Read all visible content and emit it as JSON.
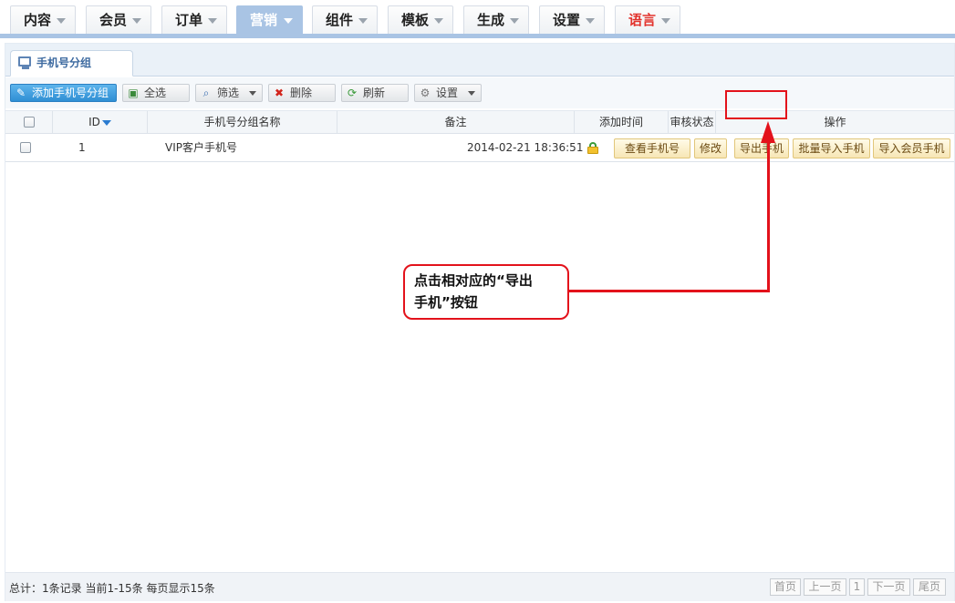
{
  "nav": {
    "items": [
      {
        "label": "内容"
      },
      {
        "label": "会员"
      },
      {
        "label": "订单"
      },
      {
        "label": "营销"
      },
      {
        "label": "组件"
      },
      {
        "label": "模板"
      },
      {
        "label": "生成"
      },
      {
        "label": "设置"
      },
      {
        "label": "语言"
      }
    ],
    "active": "营销"
  },
  "tab": {
    "label": "手机号分组"
  },
  "toolbar": {
    "add": "添加手机号分组",
    "select_all": "全选",
    "filter": "筛选",
    "delete": "删除",
    "refresh": "刷新",
    "settings": "设置"
  },
  "table": {
    "headers": {
      "id": "ID",
      "name": "手机号分组名称",
      "remark": "备注",
      "added_time": "添加时间",
      "review_status": "审核状态",
      "actions": "操作"
    },
    "rows": [
      {
        "id": "1",
        "name": "VIP客户手机号",
        "remark": "",
        "added_time": "2014-02-21 18:36:51",
        "status_icon": "unlocked-icon",
        "actions": [
          "查看手机号",
          "修改",
          "导出手机",
          "批量导入手机",
          "导入会员手机"
        ]
      }
    ]
  },
  "annotation": {
    "line1": "点击相对应的“导出",
    "line2": "手机”按钮"
  },
  "footer": {
    "summary": "总计：1条记录 当前1-15条 每页显示15条",
    "first": "首页",
    "prev": "上一页",
    "page": "1",
    "next": "下一页",
    "last": "尾页"
  },
  "colors": {
    "accent": "#a9c4e4",
    "highlight": "#e3121b",
    "language": "#e2332d"
  }
}
